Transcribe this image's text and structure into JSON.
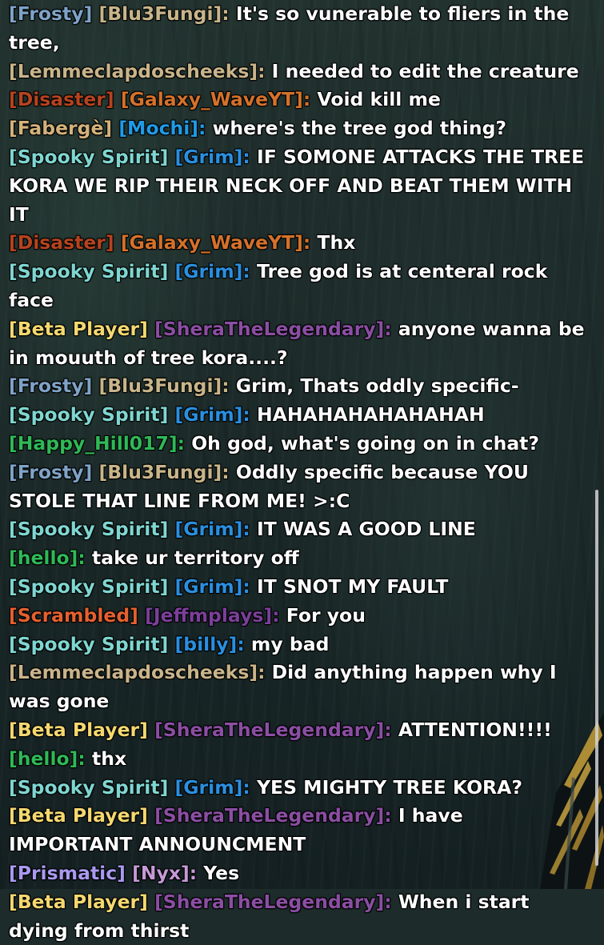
{
  "messages": [
    {
      "tags": [
        {
          "text": "[Frosty]",
          "color": "#7fa3c7"
        },
        {
          "text": "[Blu3Fungi]",
          "color": "#c8b58a"
        }
      ],
      "sep": ": ",
      "text": " It's so vunerable to fliers in the tree,"
    },
    {
      "tags": [
        {
          "text": "[Lemmeclapdoscheeks]",
          "color": "#c9b48a"
        }
      ],
      "sep": ":",
      "text": " I needed to edit the creature"
    },
    {
      "tags": [
        {
          "text": "[Disaster]",
          "color": "#b5431f"
        },
        {
          "text": "[Galaxy_WaveYT]",
          "color": "#d4712b"
        }
      ],
      "sep": ":",
      "text": " Void kill me"
    },
    {
      "tags": [
        {
          "text": "[Fabergè]",
          "color": "#d3b27a"
        },
        {
          "text": "[Mochi]",
          "color": "#1f9be8"
        }
      ],
      "sep": ": ",
      "text": " where's the tree god thing?"
    },
    {
      "tags": [
        {
          "text": "[Spooky Spirit]",
          "color": "#7fd6d1"
        },
        {
          "text": "[Grim]",
          "color": "#2a8fe0"
        }
      ],
      "sep": ":",
      "text": " IF SOMONE ATTACKS THE TREE KORA WE RIP THEIR NECK OFF AND BEAT THEM WITH IT"
    },
    {
      "tags": [
        {
          "text": "[Disaster]",
          "color": "#b5431f"
        },
        {
          "text": "[Galaxy_WaveYT]",
          "color": "#d4712b"
        }
      ],
      "sep": ":",
      "text": " Thx"
    },
    {
      "tags": [
        {
          "text": "[Spooky Spirit]",
          "color": "#7fd6d1"
        },
        {
          "text": "[Grim]",
          "color": "#2a8fe0"
        }
      ],
      "sep": ":",
      "text": " Tree god is at centeral rock face"
    },
    {
      "tags": [
        {
          "text": "[Beta Player]",
          "color": "#f4d870"
        },
        {
          "text": "[SheraTheLegendary]",
          "color": "#8b4ea3"
        }
      ],
      "sep": ":",
      "text": " anyone wanna be in mouuth of tree kora....?"
    },
    {
      "tags": [
        {
          "text": "[Frosty]",
          "color": "#7fa3c7"
        },
        {
          "text": "[Blu3Fungi]",
          "color": "#c8b58a"
        }
      ],
      "sep": ": ",
      "text": " Grim, Thats oddly specific-"
    },
    {
      "tags": [
        {
          "text": "[Spooky Spirit]",
          "color": "#7fd6d1"
        },
        {
          "text": "[Grim]",
          "color": "#2a8fe0"
        }
      ],
      "sep": ":",
      "text": " HAHAHAHAHAHAHAH"
    },
    {
      "tags": [
        {
          "text": "[Happy_Hill017]",
          "color": "#2fb957"
        }
      ],
      "sep": ":",
      "text": " Oh god, what's going on in chat?"
    },
    {
      "tags": [
        {
          "text": "[Frosty]",
          "color": "#7fa3c7"
        },
        {
          "text": "[Blu3Fungi]",
          "color": "#c8b58a"
        }
      ],
      "sep": ": ",
      "text": " Oddly specific because YOU STOLE THAT LINE FROM ME! >:C"
    },
    {
      "tags": [
        {
          "text": "[Spooky Spirit]",
          "color": "#7fd6d1"
        },
        {
          "text": "[Grim]",
          "color": "#2a8fe0"
        }
      ],
      "sep": ":",
      "text": " IT WAS A GOOD LINE"
    },
    {
      "tags": [
        {
          "text": "[hello]",
          "color": "#2fb957"
        }
      ],
      "sep": ":",
      "text": " take ur territory off"
    },
    {
      "tags": [
        {
          "text": "[Spooky Spirit]",
          "color": "#7fd6d1"
        },
        {
          "text": "[Grim]",
          "color": "#2a8fe0"
        }
      ],
      "sep": ":",
      "text": " IT SNOT MY FAULT"
    },
    {
      "tags": [
        {
          "text": "[Scrambled]",
          "color": "#e5602f"
        },
        {
          "text": "[Jeffmplays]",
          "color": "#7b3f9a"
        }
      ],
      "sep": ": ",
      "text": " For you"
    },
    {
      "tags": [
        {
          "text": "[Spooky Spirit]",
          "color": "#7fd6d1"
        },
        {
          "text": "[billy]",
          "color": "#2a8fe0"
        }
      ],
      "sep": ":",
      "text": " my bad"
    },
    {
      "tags": [
        {
          "text": "[Lemmeclapdoscheeks]",
          "color": "#c9b48a"
        }
      ],
      "sep": ":",
      "text": " Did anything happen why I was gone"
    },
    {
      "tags": [
        {
          "text": "[Beta Player]",
          "color": "#f4d870"
        },
        {
          "text": "[SheraTheLegendary]",
          "color": "#8b4ea3"
        }
      ],
      "sep": ":",
      "text": " ATTENTION!!!!"
    },
    {
      "tags": [
        {
          "text": "[hello]",
          "color": "#2fb957"
        }
      ],
      "sep": ":",
      "text": " thx"
    },
    {
      "tags": [
        {
          "text": "[Spooky Spirit]",
          "color": "#7fd6d1"
        },
        {
          "text": "[Grim]",
          "color": "#2a8fe0"
        }
      ],
      "sep": ":",
      "text": " YES MIGHTY TREE KORA?"
    },
    {
      "tags": [
        {
          "text": "[Beta Player]",
          "color": "#f4d870"
        },
        {
          "text": "[SheraTheLegendary]",
          "color": "#8b4ea3"
        }
      ],
      "sep": ":",
      "text": " I have IMPORTANT ANNOUNCMENT"
    },
    {
      "tags": [
        {
          "text": "[Prismatic]",
          "color": "#a99af0"
        },
        {
          "text": "[Nyx]",
          "color": "#c59ad6"
        }
      ],
      "sep": ":",
      "text": " Yes"
    },
    {
      "tags": [
        {
          "text": "[Beta Player]",
          "color": "#f4d870"
        },
        {
          "text": "[SheraTheLegendary]",
          "color": "#8b4ea3"
        }
      ],
      "sep": ":",
      "text": " When i start dying from thirst"
    }
  ],
  "scrollbar": {
    "position_fraction": 1.0,
    "visible_fraction": 0.42
  }
}
